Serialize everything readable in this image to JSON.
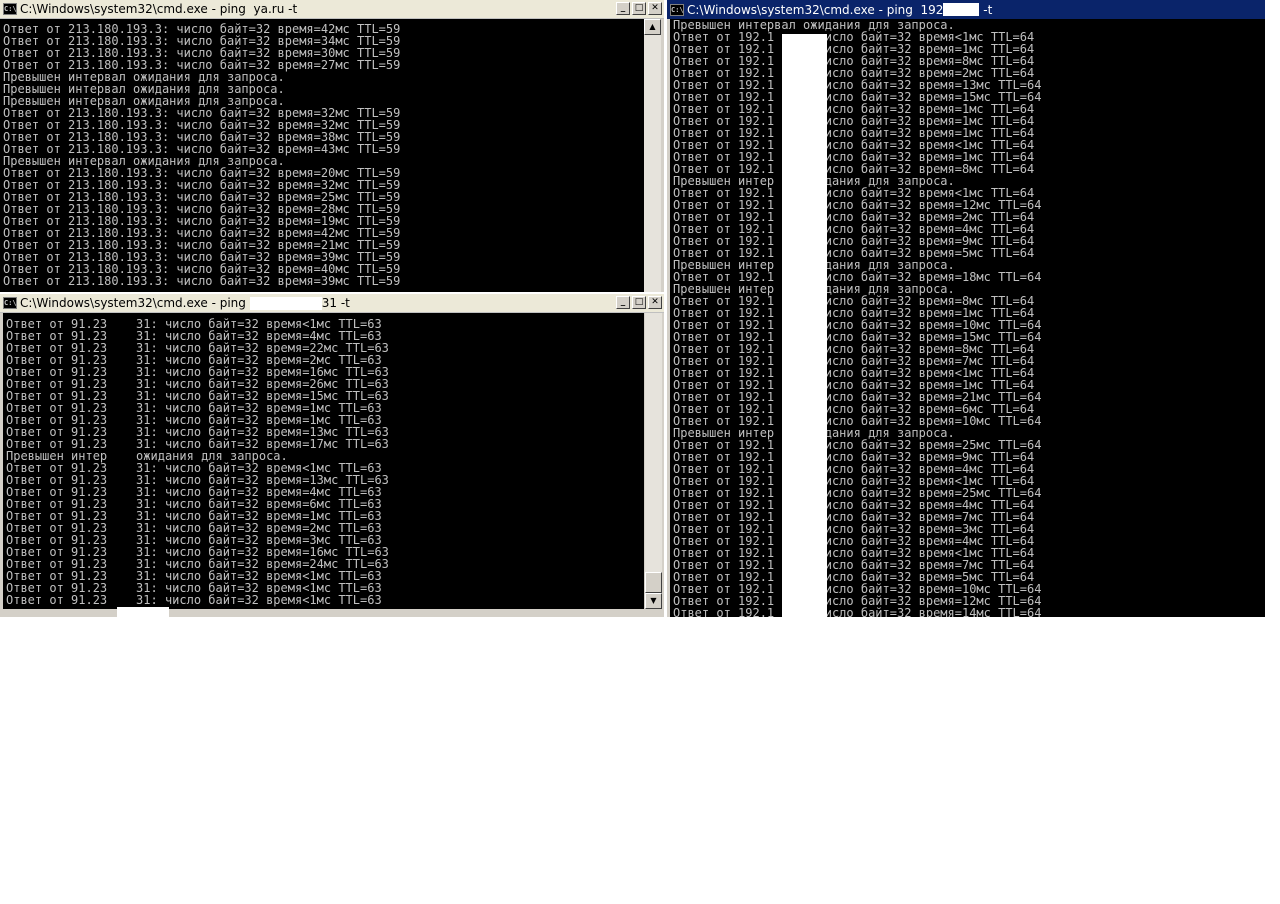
{
  "windows": {
    "ya": {
      "title": "C:\\Windows\\system32\\cmd.exe - ping  ya.ru -t",
      "lines": [
        "Ответ от 213.180.193.3: число байт=32 время=42мс TTL=59",
        "Ответ от 213.180.193.3: число байт=32 время=34мс TTL=59",
        "Ответ от 213.180.193.3: число байт=32 время=30мс TTL=59",
        "Ответ от 213.180.193.3: число байт=32 время=27мс TTL=59",
        "Превышен интервал ожидания для запроса.",
        "Превышен интервал ожидания для запроса.",
        "Превышен интервал ожидания для запроса.",
        "Ответ от 213.180.193.3: число байт=32 время=32мс TTL=59",
        "Ответ от 213.180.193.3: число байт=32 время=32мс TTL=59",
        "Ответ от 213.180.193.3: число байт=32 время=38мс TTL=59",
        "Ответ от 213.180.193.3: число байт=32 время=43мс TTL=59",
        "Превышен интервал ожидания для запроса.",
        "Ответ от 213.180.193.3: число байт=32 время=20мс TTL=59",
        "Ответ от 213.180.193.3: число байт=32 время=32мс TTL=59",
        "Ответ от 213.180.193.3: число байт=32 время=25мс TTL=59",
        "Ответ от 213.180.193.3: число байт=32 время=28мс TTL=59",
        "Ответ от 213.180.193.3: число байт=32 время=19мс TTL=59",
        "Ответ от 213.180.193.3: число байт=32 время=42мс TTL=59",
        "Ответ от 213.180.193.3: число байт=32 время=21мс TTL=59",
        "Ответ от 213.180.193.3: число байт=32 время=39мс TTL=59",
        "Ответ от 213.180.193.3: число байт=32 время=40мс TTL=59",
        "Ответ от 213.180.193.3: число байт=32 время=39мс TTL=59"
      ]
    },
    "host91": {
      "title_prefix": "C:\\Windows\\system32\\cmd.exe - ping ",
      "title_suffix": "31 -t",
      "lines": [
        "Ответ от 91.23    31: число байт=32 время<1мс TTL=63",
        "Ответ от 91.23    31: число байт=32 время=4мс TTL=63",
        "Ответ от 91.23    31: число байт=32 время=22мс TTL=63",
        "Ответ от 91.23    31: число байт=32 время=2мс TTL=63",
        "Ответ от 91.23    31: число байт=32 время=16мс TTL=63",
        "Ответ от 91.23    31: число байт=32 время=26мс TTL=63",
        "Ответ от 91.23    31: число байт=32 время=15мс TTL=63",
        "Ответ от 91.23    31: число байт=32 время=1мс TTL=63",
        "Ответ от 91.23    31: число байт=32 время=1мс TTL=63",
        "Ответ от 91.23    31: число байт=32 время=13мс TTL=63",
        "Ответ от 91.23    31: число байт=32 время=17мс TTL=63",
        "Превышен интер    ожидания для запроса.",
        "Ответ от 91.23    31: число байт=32 время<1мс TTL=63",
        "Ответ от 91.23    31: число байт=32 время=13мс TTL=63",
        "Ответ от 91.23    31: число байт=32 время=4мс TTL=63",
        "Ответ от 91.23    31: число байт=32 время=6мс TTL=63",
        "Ответ от 91.23    31: число байт=32 время=1мс TTL=63",
        "Ответ от 91.23    31: число байт=32 время=2мс TTL=63",
        "Ответ от 91.23    31: число байт=32 время=3мс TTL=63",
        "Ответ от 91.23    31: число байт=32 время=16мс TTL=63",
        "Ответ от 91.23    31: число байт=32 время=24мс TTL=63",
        "Ответ от 91.23    31: число байт=32 время<1мс TTL=63",
        "Ответ от 91.23    31: число байт=32 время<1мс TTL=63",
        "Ответ от 91.23    31: число байт=32 время<1мс TTL=63"
      ]
    },
    "host192": {
      "title_prefix": "C:\\Windows\\system32\\cmd.exe - ping  192",
      "title_suffix": " -t",
      "lines": [
        "Превышен интервал ожидания для запроса.",
        "Ответ от 192.1    : число байт=32 время<1мс TTL=64",
        "Ответ от 192.1    : число байт=32 время=1мс TTL=64",
        "Ответ от 192.1    : число байт=32 время=8мс TTL=64",
        "Ответ от 192.1    : число байт=32 время=2мс TTL=64",
        "Ответ от 192.1    : число байт=32 время=13мс TTL=64",
        "Ответ от 192.1    : число байт=32 время=15мс TTL=64",
        "Ответ от 192.1    : число байт=32 время=1мс TTL=64",
        "Ответ от 192.1    : число байт=32 время=1мс TTL=64",
        "Ответ от 192.1    : число байт=32 время=1мс TTL=64",
        "Ответ от 192.1    : число байт=32 время<1мс TTL=64",
        "Ответ от 192.1    : число байт=32 время=1мс TTL=64",
        "Ответ от 192.1    : число байт=32 время=8мс TTL=64",
        "Превышен интер    ожидания для запроса.",
        "Ответ от 192.1    : число байт=32 время<1мс TTL=64",
        "Ответ от 192.1    : число байт=32 время=12мс TTL=64",
        "Ответ от 192.1    : число байт=32 время=2мс TTL=64",
        "Ответ от 192.1    : число байт=32 время=4мс TTL=64",
        "Ответ от 192.1    : число байт=32 время=9мс TTL=64",
        "Ответ от 192.1    : число байт=32 время=5мс TTL=64",
        "Превышен интер    ожидания для запроса.",
        "Ответ от 192.1    : число байт=32 время=18мс TTL=64",
        "Превышен интер    ожидания для запроса.",
        "Ответ от 192.1    : число байт=32 время=8мс TTL=64",
        "Ответ от 192.1    : число байт=32 время=1мс TTL=64",
        "Ответ от 192.1    : число байт=32 время=10мс TTL=64",
        "Ответ от 192.1    : число байт=32 время=15мс TTL=64",
        "Ответ от 192.1    : число байт=32 время=8мс TTL=64",
        "Ответ от 192.1    : число байт=32 время=7мс TTL=64",
        "Ответ от 192.1    : число байт=32 время<1мс TTL=64",
        "Ответ от 192.1    : число байт=32 время=1мс TTL=64",
        "Ответ от 192.1    : число байт=32 время=21мс TTL=64",
        "Ответ от 192.1    : число байт=32 время=6мс TTL=64",
        "Ответ от 192.1    : число байт=32 время=10мс TTL=64",
        "Превышен интер    ожидания для запроса.",
        "Ответ от 192.1    : число байт=32 время=25мс TTL=64",
        "Ответ от 192.1    : число байт=32 время=9мс TTL=64",
        "Ответ от 192.1    : число байт=32 время=4мс TTL=64",
        "Ответ от 192.1    : число байт=32 время<1мс TTL=64",
        "Ответ от 192.1    : число байт=32 время=25мс TTL=64",
        "Ответ от 192.1    : число байт=32 время=4мс TTL=64",
        "Ответ от 192.1    : число байт=32 время=7мс TTL=64",
        "Ответ от 192.1    : число байт=32 время=3мс TTL=64",
        "Ответ от 192.1    : число байт=32 время=4мс TTL=64",
        "Ответ от 192.1    : число байт=32 время<1мс TTL=64",
        "Ответ от 192.1    : число байт=32 время=7мс TTL=64",
        "Ответ от 192.1    : число байт=32 время=5мс TTL=64",
        "Ответ от 192.1    : число байт=32 время=10мс TTL=64",
        "Ответ от 192.1    : число байт=32 время=12мс TTL=64",
        "Ответ от 192.1    : число байт=32 время=14мс TTL=64"
      ]
    }
  },
  "controls": {
    "minimize": "_",
    "maximize": "□",
    "close": "✕",
    "up": "▲",
    "down": "▼"
  },
  "colors": {
    "console_bg": "#000000",
    "console_fg": "#c0c0c0",
    "active_title": "#0a246a",
    "inactive_title": "#ece9d8",
    "frame": "#d4d0c8"
  }
}
